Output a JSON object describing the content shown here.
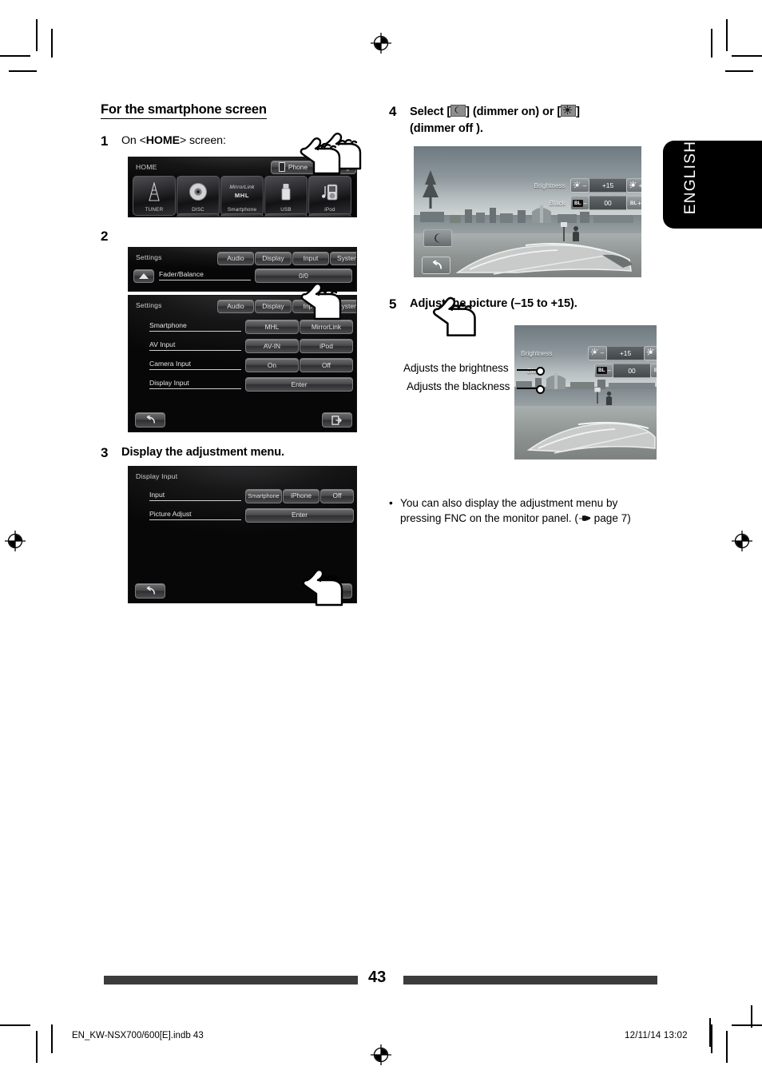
{
  "language_tab": {
    "label": "ENGLISH"
  },
  "section": {
    "title": "For the smartphone screen"
  },
  "steps": {
    "one": {
      "num": "1",
      "text_prefix": "On <",
      "text_bold": "HOME",
      "text_suffix": "> screen:"
    },
    "two": {
      "num": "2"
    },
    "three": {
      "num": "3",
      "title": "Display the adjustment menu."
    },
    "four": {
      "num": "4",
      "line1_a": "Select [",
      "line1_b": "] (dimmer on) or [",
      "line1_c": "]",
      "line2": "(dimmer off )."
    },
    "five": {
      "num": "5",
      "title": "Adjust the picture (–15 to +15)."
    }
  },
  "home_screen": {
    "title": "HOME",
    "phone_button": "Phone",
    "settings_button": "Settings",
    "sources": [
      {
        "label": "TUNER",
        "icon": "antenna-icon"
      },
      {
        "label": "DISC",
        "icon": "disc-icon"
      },
      {
        "label": "Smartphone",
        "icon": "mirrorlink-mhl-icon",
        "line1": "MirrorLink",
        "line2": "MHL"
      },
      {
        "label": "USB",
        "icon": "usb-icon"
      },
      {
        "label": "iPod",
        "icon": "ipod-icon"
      }
    ]
  },
  "settings_screen_a": {
    "title": "Settings",
    "tabs": [
      "Audio",
      "Display",
      "Input",
      "System"
    ],
    "row_label": "Fader/Balance",
    "row_value": "0/0"
  },
  "settings_screen_b": {
    "title": "Settings",
    "tabs": [
      "Audio",
      "Display",
      "Input",
      "System"
    ],
    "rows": [
      {
        "label": "Smartphone",
        "buttons": [
          "MHL",
          "MirrorLink"
        ]
      },
      {
        "label": "AV Input",
        "buttons": [
          "AV-IN",
          "iPod"
        ]
      },
      {
        "label": "Camera Input",
        "buttons": [
          "On",
          "Off"
        ]
      },
      {
        "label": "Display Input",
        "buttons": [
          "Enter"
        ]
      }
    ],
    "back_icon": "back-arrow-icon",
    "exit_icon": "exit-icon"
  },
  "display_input_screen": {
    "title": "Display Input",
    "rows": [
      {
        "label": "Input",
        "buttons": [
          "Smartphone",
          "iPhone",
          "Off"
        ]
      },
      {
        "label": "Picture Adjust",
        "buttons": [
          "Enter"
        ]
      }
    ],
    "back_icon": "back-arrow-icon",
    "exit_icon": "exit-icon"
  },
  "picture_adjust": {
    "brightness_label": "Brightness",
    "brightness_value": "+15",
    "black_label": "Black",
    "black_value": "00",
    "minus": "–",
    "plus": "+",
    "brightness_icon": "sun-icon",
    "black_icon": "bl-icon",
    "dimmer_icon": "moon-icon",
    "back_icon": "back-arrow-icon"
  },
  "callouts": {
    "brightness": "Adjusts the brightness",
    "blackness": "Adjusts the blackness"
  },
  "note": {
    "bullet": "•",
    "line1": "You can also display the adjustment menu by",
    "line2_a": "pressing FNC on the monitor panel. (",
    "line2_icon": "pointing-hand-icon",
    "line2_b": " page 7)"
  },
  "footer": {
    "page_number": "43",
    "file_name": "EN_KW-NSX700/600[E].indb   43",
    "timestamp": "12/11/14   13:02"
  },
  "colors": {
    "rule": "#3c3c3c",
    "tab_bg": "#000000",
    "lcd_bg": "#0b0b0c"
  }
}
